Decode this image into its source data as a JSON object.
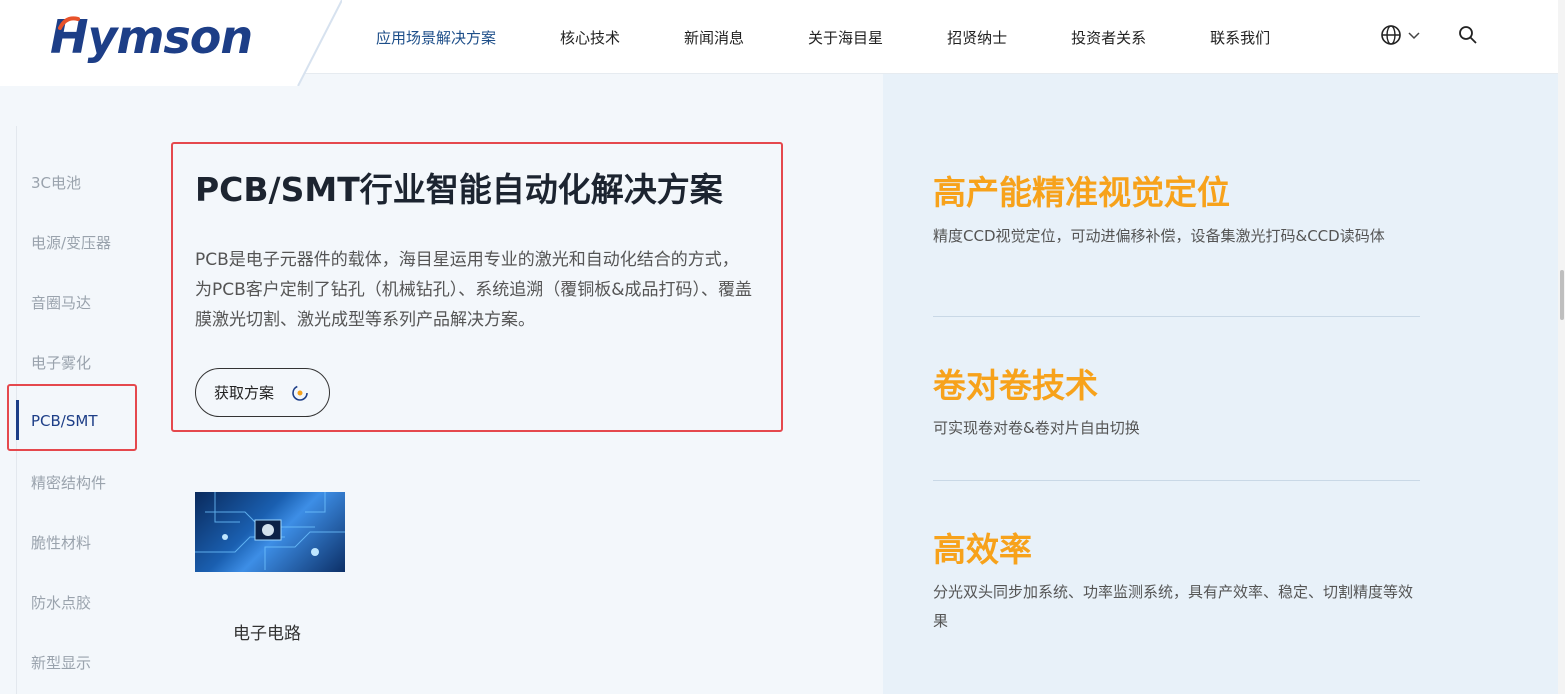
{
  "header": {
    "logo_text": "Hymson",
    "nav": [
      {
        "label": "应用场景解决方案",
        "active": true
      },
      {
        "label": "核心技术",
        "active": false
      },
      {
        "label": "新闻消息",
        "active": false
      },
      {
        "label": "关于海目星",
        "active": false
      },
      {
        "label": "招贤纳士",
        "active": false
      },
      {
        "label": "投资者关系",
        "active": false
      },
      {
        "label": "联系我们",
        "active": false
      }
    ],
    "icons": [
      "globe-icon",
      "chevron-down-icon",
      "search-icon"
    ]
  },
  "sidebar": {
    "items": [
      {
        "label": "3C电池"
      },
      {
        "label": "电源/变压器"
      },
      {
        "label": "音圈马达"
      },
      {
        "label": "电子雾化"
      },
      {
        "label": "PCB/SMT"
      },
      {
        "label": "精密结构件"
      },
      {
        "label": "脆性材料"
      },
      {
        "label": "防水点胶"
      },
      {
        "label": "新型显示"
      }
    ],
    "active_index": 4
  },
  "main": {
    "title": "PCB/SMT行业智能自动化解决方案",
    "description": "PCB是电子元器件的载体，海目星运用专业的激光和自动化结合的方式，为PCB客户定制了钻孔（机械钻孔）、系统追溯（覆铜板&成品打码）、覆盖膜激光切割、激光成型等系列产品解决方案。",
    "button_label": "获取方案",
    "thumbnail_label": "电子电路"
  },
  "features": [
    {
      "title": "高产能精准视觉定位",
      "desc": "精度CCD视觉定位，可动进偏移补偿，设备集激光打码&CCD读码体"
    },
    {
      "title": "卷对卷技术",
      "desc": "可实现卷对卷&卷对片自由切换"
    },
    {
      "title": "高效率",
      "desc": "分光双头同步加系统、功率监测系统，具有产效率、稳定、切割精度等效果"
    }
  ],
  "colors": {
    "brand": "#1d3e87",
    "accent": "#f7a21b",
    "highlight": "#e5484d"
  }
}
